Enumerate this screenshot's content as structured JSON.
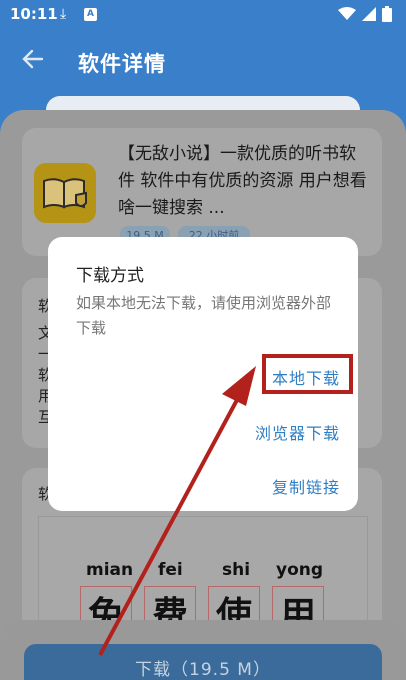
{
  "status": {
    "time": "10:11",
    "icons": [
      "download-icon",
      "a-badge-icon",
      "wifi-icon",
      "signal-icon",
      "battery-icon"
    ]
  },
  "app_bar": {
    "title": "软件详情",
    "back": "←"
  },
  "app_info": {
    "description": "【无敌小说】一款优质的听书软件 软件中有优质的资源 用户想看啥一键搜索 ...",
    "tags": [
      "19.5 M",
      "22 小时前"
    ]
  },
  "intro": {
    "lines": [
      "软",
      "文",
      "一",
      "软",
      "用",
      "互"
    ]
  },
  "screenshots": {
    "title": "软",
    "pinyin": [
      "mian",
      "fei",
      "shi",
      "yong"
    ],
    "hanzi": [
      "免",
      "费",
      "使",
      "用"
    ]
  },
  "download": {
    "label": "下载（19.5 M）"
  },
  "dialog": {
    "title": "下载方式",
    "message": "如果本地无法下载，请使用浏览器外部下载",
    "buttons": {
      "local": "本地下载",
      "browser": "浏览器下载",
      "copy": "复制链接"
    }
  },
  "colors": {
    "primary": "#3a7fc9",
    "link": "#2f7fc6",
    "highlight": "#b3211c"
  }
}
